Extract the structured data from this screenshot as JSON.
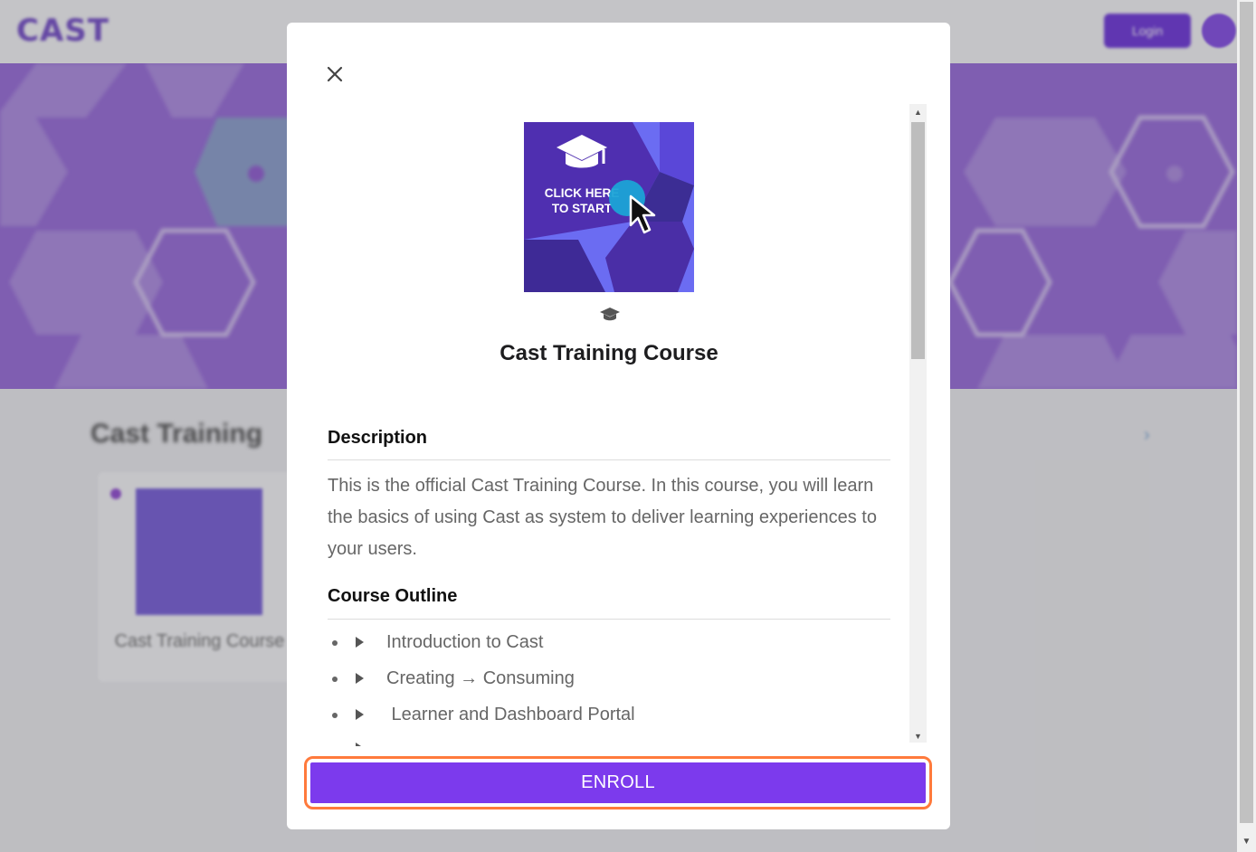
{
  "background": {
    "logo": "CAST",
    "login_label": "Login",
    "section_title": "Cast Training",
    "card_title": "Cast Training Course"
  },
  "modal": {
    "close_icon": "close-icon",
    "image": {
      "line1": "CLICK HERE",
      "line2": "TO START",
      "icons": [
        "graduation-cap-icon",
        "cursor-pointer-icon"
      ]
    },
    "type_icon": "graduation-cap-icon",
    "title": "Cast Training Course",
    "description_heading": "Description",
    "description": "This is the official Cast Training Course. In this course, you will learn the basics of using Cast as system to deliver learning experiences to your users.",
    "outline_heading": "Course Outline",
    "outline": [
      {
        "label": "Introduction to Cast"
      },
      {
        "label": "Creating → Consuming"
      },
      {
        "label": " Learner and Dashboard Portal"
      }
    ],
    "enroll_label": "ENROLL"
  },
  "colors": {
    "accent": "#7c3aed",
    "highlight_border": "#ff7a3c",
    "hero_purple": "#9160d8"
  }
}
